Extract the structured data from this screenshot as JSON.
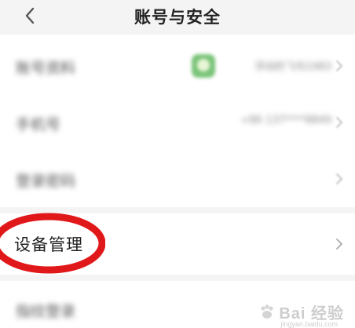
{
  "header": {
    "title": "账号与安全",
    "back_icon": "chevron-left-icon"
  },
  "rows": [
    {
      "label": "账号资料",
      "value": "浮动的飞鸟1983",
      "has_avatar": true
    },
    {
      "label": "手机号",
      "value": "+86 137****8849"
    },
    {
      "label": "登录密码",
      "value": ""
    },
    {
      "label": "设备管理",
      "value": ""
    },
    {
      "label": "指纹登录",
      "value": ""
    }
  ],
  "annotation": {
    "color": "#e0181a"
  },
  "watermark": {
    "text": "Bai 经验",
    "sub": "jingyan.baidu.com"
  },
  "colors": {
    "background": "#f4f4f4",
    "card": "#ffffff",
    "title": "#222222",
    "chevron": "#bbbbbb",
    "avatar": "#7bc47a"
  }
}
